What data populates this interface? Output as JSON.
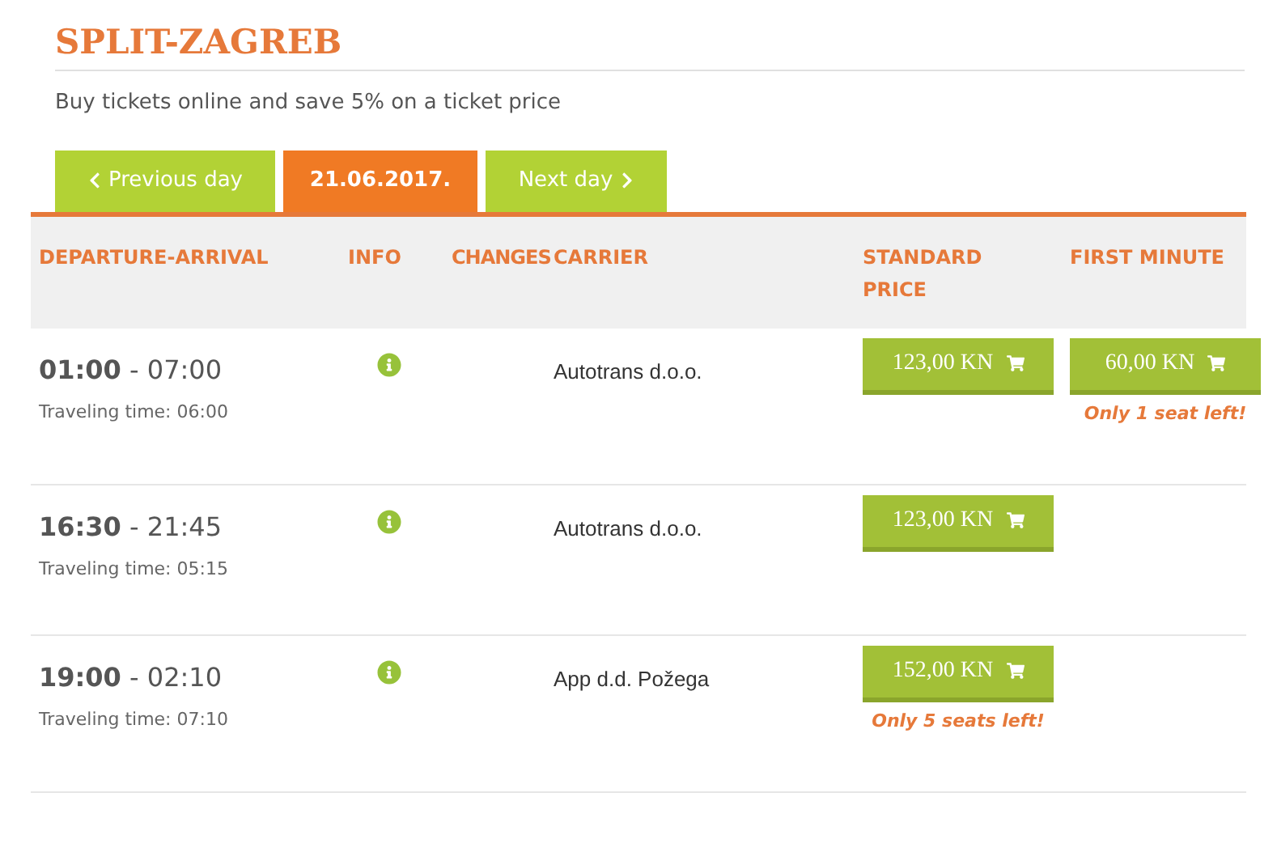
{
  "title": "SPLIT-ZAGREB",
  "subtitle": "Buy tickets online and save 5% on a ticket price",
  "tabs": [
    {
      "label": "Previous day",
      "kind": "prev",
      "selected": false
    },
    {
      "label": "21.06.2017.",
      "kind": "date",
      "selected": true
    },
    {
      "label": "Next day",
      "kind": "next",
      "selected": false
    }
  ],
  "columns": [
    "DEPARTURE-ARRIVAL",
    "INFO",
    "CHANGES",
    "CARRIER",
    "STANDARD PRICE",
    "FIRST MINUTE"
  ],
  "rows": [
    {
      "time": "**01:00** - 07:00",
      "travel_time": "Traveling time: 06:00",
      "carrier": "Autotrans d.o.o.",
      "standard": {
        "price": "123,00 KN"
      },
      "first_minute": {
        "price": "60,00 KN",
        "note": "Only 1 seat left!"
      }
    },
    {
      "time": "**16:30** - 21:45",
      "travel_time": "Traveling time: 05:15",
      "carrier": "Autotrans d.o.o.",
      "standard": {
        "price": "123,00 KN"
      }
    },
    {
      "time": "**19:00** - 02:10",
      "travel_time": "Traveling time: 07:10",
      "carrier": "App d.d. Požega",
      "standard": {
        "price": "152,00 KN",
        "note": "Only 5 seats left!"
      }
    }
  ]
}
